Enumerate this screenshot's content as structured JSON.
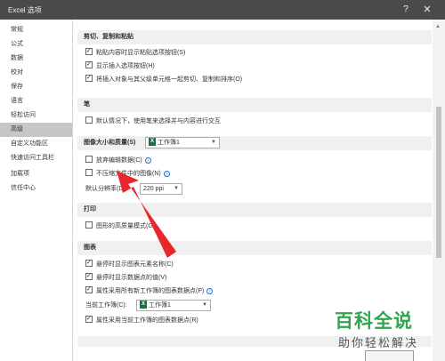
{
  "window": {
    "title": "Excel 选项",
    "help_icon": "question-mark-icon",
    "close_icon": "close-icon"
  },
  "sidebar": {
    "items": [
      {
        "label": "常规"
      },
      {
        "label": "公式"
      },
      {
        "label": "数据"
      },
      {
        "label": "校对"
      },
      {
        "label": "保存"
      },
      {
        "label": "语言"
      },
      {
        "label": "轻松访问"
      },
      {
        "label": "高级",
        "selected": true
      },
      {
        "label": "自定义功能区"
      },
      {
        "label": "快速访问工具栏"
      },
      {
        "label": "加载项"
      },
      {
        "label": "信任中心"
      }
    ]
  },
  "sections": {
    "cut_copy_paste": {
      "header": "剪切、复制和粘贴",
      "options": [
        {
          "label": "粘贴内容时显示粘贴选项按钮(S)",
          "checked": true
        },
        {
          "label": "显示插入选项按钮(H)",
          "checked": true
        },
        {
          "label": "将插入对象与其父级单元格一起剪切、复制和排序(O)",
          "checked": true
        }
      ]
    },
    "pen": {
      "header": "笔",
      "options": [
        {
          "label": "默认情况下，使用笔来选择并与内容进行交互",
          "checked": false
        }
      ]
    },
    "image_size": {
      "header_label": "图像大小和质量(S)",
      "workbook_select": "工作簿1",
      "options": [
        {
          "label": "放弃编辑数据(C)",
          "checked": false
        },
        {
          "label": "不压缩文件中的图像(N)",
          "checked": false
        }
      ],
      "resolution_label": "默认分辨率(D):",
      "resolution_value": "220 ppi"
    },
    "print": {
      "header": "打印",
      "options": [
        {
          "label": "图形的高质量模式(G)",
          "checked": false
        }
      ]
    },
    "chart": {
      "header": "图表",
      "options": [
        {
          "label": "悬停时显示图表元素名称(C)",
          "checked": true
        },
        {
          "label": "悬停时显示数据点的值(V)",
          "checked": true
        },
        {
          "label": "属性采用所有新工作簿的图表数据点(P)",
          "checked": true
        }
      ],
      "current_workbook_label": "当前工作簿(C):",
      "current_workbook_value": "工作簿1",
      "option_current": {
        "label": "属性采用当前工作簿的图表数据点(R)",
        "checked": true
      }
    }
  },
  "watermark": {
    "title": "百科全说",
    "subtitle": "助你轻松解决"
  },
  "colors": {
    "titlebar": "#4a4a4a",
    "selected": "#c6c6c6",
    "arrow": "#e8262b",
    "excel_green": "#1e7145",
    "watermark_green": "#2ea64c"
  }
}
